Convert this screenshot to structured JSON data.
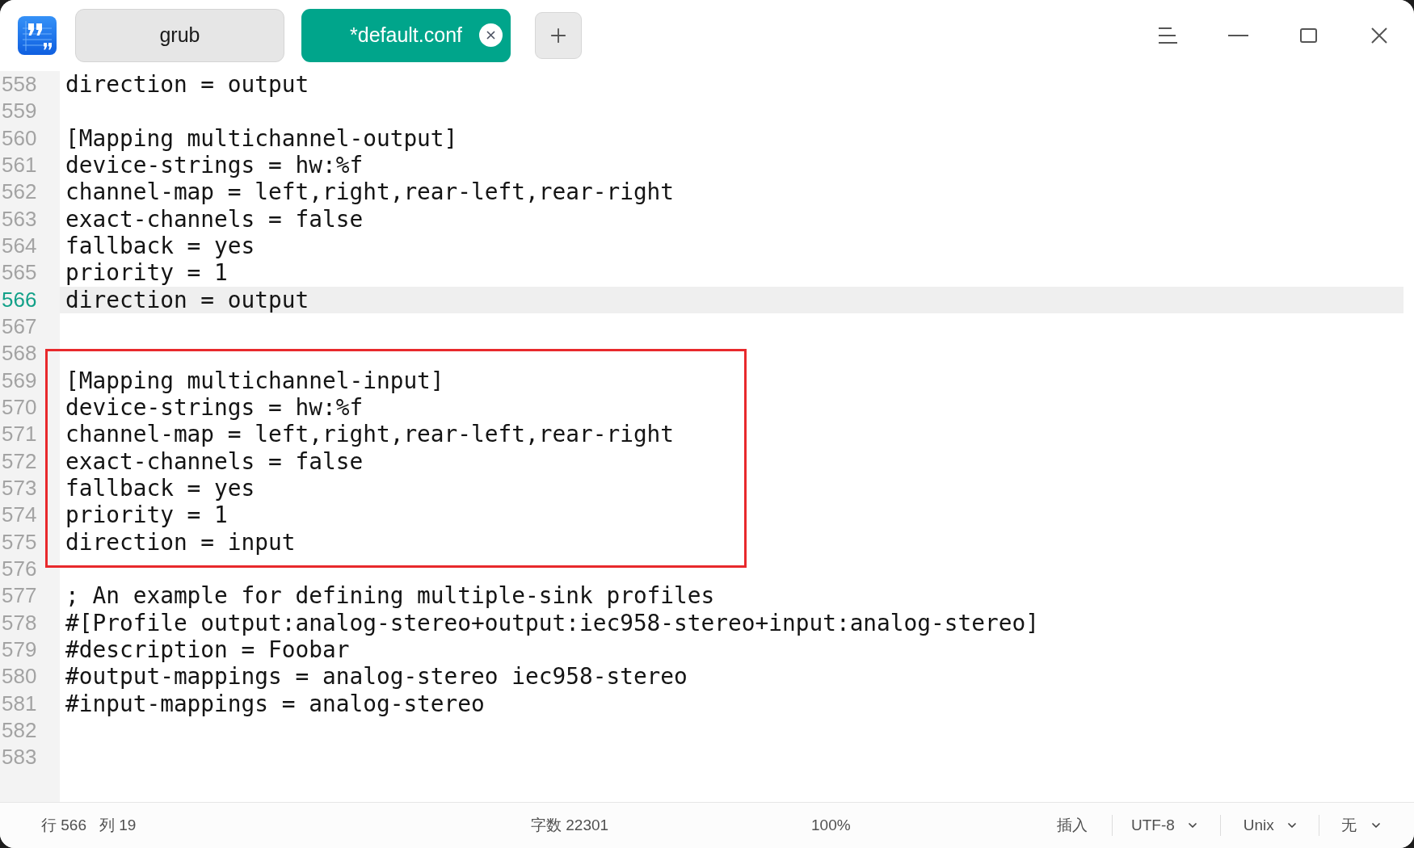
{
  "tabs": [
    {
      "label": "grub",
      "selected": false
    },
    {
      "label": "*default.conf",
      "selected": true
    }
  ],
  "editor": {
    "sections": [
      {
        "boxed": false,
        "lines": [
          {
            "number": "558",
            "text": "direction = output",
            "current": false
          },
          {
            "number": "559",
            "current": false
          },
          {
            "number": "560",
            "text": "[Mapping multichannel-output]",
            "current": false
          },
          {
            "number": "561",
            "text": "device-strings = hw:%f",
            "current": false
          },
          {
            "number": "562",
            "text": "channel-map = left,right,rear-left,rear-right",
            "current": false
          },
          {
            "number": "563",
            "text": "exact-channels = false",
            "current": false
          },
          {
            "number": "564",
            "text": "fallback = yes",
            "current": false
          },
          {
            "number": "565",
            "text": "priority = 1",
            "current": false
          },
          {
            "number": "566",
            "text": "direction = output",
            "current": true
          },
          {
            "number": "567",
            "current": false
          },
          {
            "number": "568",
            "current": false
          }
        ]
      },
      {
        "boxed": true,
        "lines": [
          {
            "number": "569",
            "text": "[Mapping multichannel-input]",
            "current": false
          },
          {
            "number": "570",
            "text": "device-strings = hw:%f",
            "current": false
          },
          {
            "number": "571",
            "text": "channel-map = left,right,rear-left,rear-right",
            "current": false
          },
          {
            "number": "572",
            "text": "exact-channels = false",
            "current": false
          },
          {
            "number": "573",
            "text": "fallback = yes",
            "current": false
          },
          {
            "number": "574",
            "text": "priority = 1",
            "current": false
          },
          {
            "number": "575",
            "text": "direction = input",
            "current": false
          }
        ]
      },
      {
        "boxed": false,
        "lines": [
          {
            "number": "576",
            "current": false
          },
          {
            "number": "577",
            "text": "; An example for defining multiple-sink profiles",
            "current": false
          },
          {
            "number": "578",
            "text": "#[Profile output:analog-stereo+output:iec958-stereo+input:analog-stereo]",
            "current": false
          },
          {
            "number": "579",
            "text": "#description = Foobar",
            "current": false
          },
          {
            "number": "580",
            "text": "#output-mappings = analog-stereo iec958-stereo",
            "current": false
          },
          {
            "number": "581",
            "text": "#input-mappings = analog-stereo",
            "current": false
          },
          {
            "number": "582",
            "current": false
          },
          {
            "number": "583",
            "current": false
          }
        ]
      }
    ]
  },
  "status_bar": {
    "line": "行 566",
    "column": "列 19",
    "char_count": "字数 22301",
    "zoom": "100%",
    "input_mode": "插入",
    "selectors": [
      {
        "label": "UTF-8"
      },
      {
        "label": "Unix"
      },
      {
        "label": "无"
      }
    ]
  }
}
